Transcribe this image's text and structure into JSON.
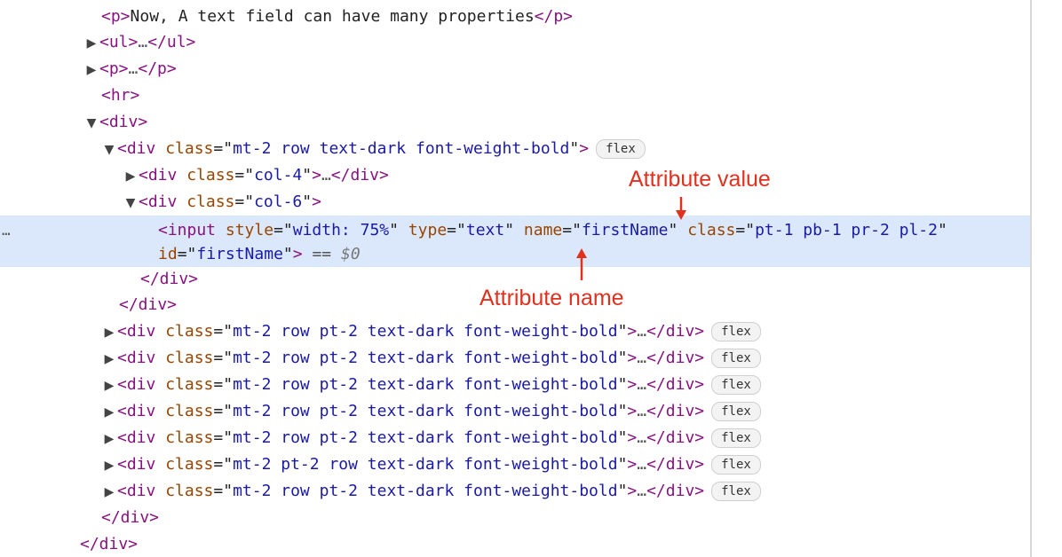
{
  "elements": {
    "row1": {
      "text": "Now, A text field can have many properties"
    },
    "row2": {
      "tag": "ul"
    },
    "row3": {
      "tag": "p"
    },
    "row4": {
      "tag": "hr"
    },
    "row5": {
      "tag": "div"
    },
    "row6": {
      "class": "mt-2 row text-dark font-weight-bold",
      "badge": "flex"
    },
    "row7": {
      "class": "col-4"
    },
    "row8": {
      "class": "col-6"
    },
    "selected": {
      "tag": "input",
      "style": "width: 75%",
      "type": "text",
      "name": "firstName",
      "class": "pt-1 pb-1 pr-2 pl-2",
      "id": "firstName",
      "eq": "==",
      "ref": "$0",
      "gutter": "…"
    },
    "rows_collapsed": [
      {
        "class": "mt-2 row pt-2 text-dark font-weight-bold",
        "badge": "flex"
      },
      {
        "class": "mt-2 row pt-2 text-dark font-weight-bold",
        "badge": "flex"
      },
      {
        "class": "mt-2 row pt-2 text-dark font-weight-bold",
        "badge": "flex"
      },
      {
        "class": "mt-2 row pt-2 text-dark font-weight-bold",
        "badge": "flex"
      },
      {
        "class": "mt-2 row pt-2 text-dark font-weight-bold",
        "badge": "flex"
      },
      {
        "class": "mt-2 pt-2 row text-dark font-weight-bold",
        "badge": "flex"
      },
      {
        "class": "mt-2 row pt-2 text-dark font-weight-bold",
        "badge": "flex"
      }
    ]
  },
  "syntax": {
    "p_open": "<p>",
    "p_close": "</p>",
    "ul_open": "<ul>",
    "ul_close": "</ul>",
    "hr": "<hr>",
    "div_open": "<div>",
    "div_attr_open": "<div",
    "div_close": "</div>",
    "input_open": "<input",
    "class_attr": "class",
    "style_attr": "style",
    "type_attr": "type",
    "name_attr": "name",
    "id_attr": "id",
    "eq_quote": "=\"",
    "quote": "\"",
    "tag_end": ">",
    "ellipsis": "…"
  },
  "annotations": {
    "attribute_value": "Attribute value",
    "attribute_name": "Attribute name"
  },
  "colors": {
    "tag": "#881280",
    "attribute_name": "#994500",
    "attribute_value": "#1a1aa6",
    "selection": "#dbe8fb",
    "annotation": "#e0311f"
  }
}
